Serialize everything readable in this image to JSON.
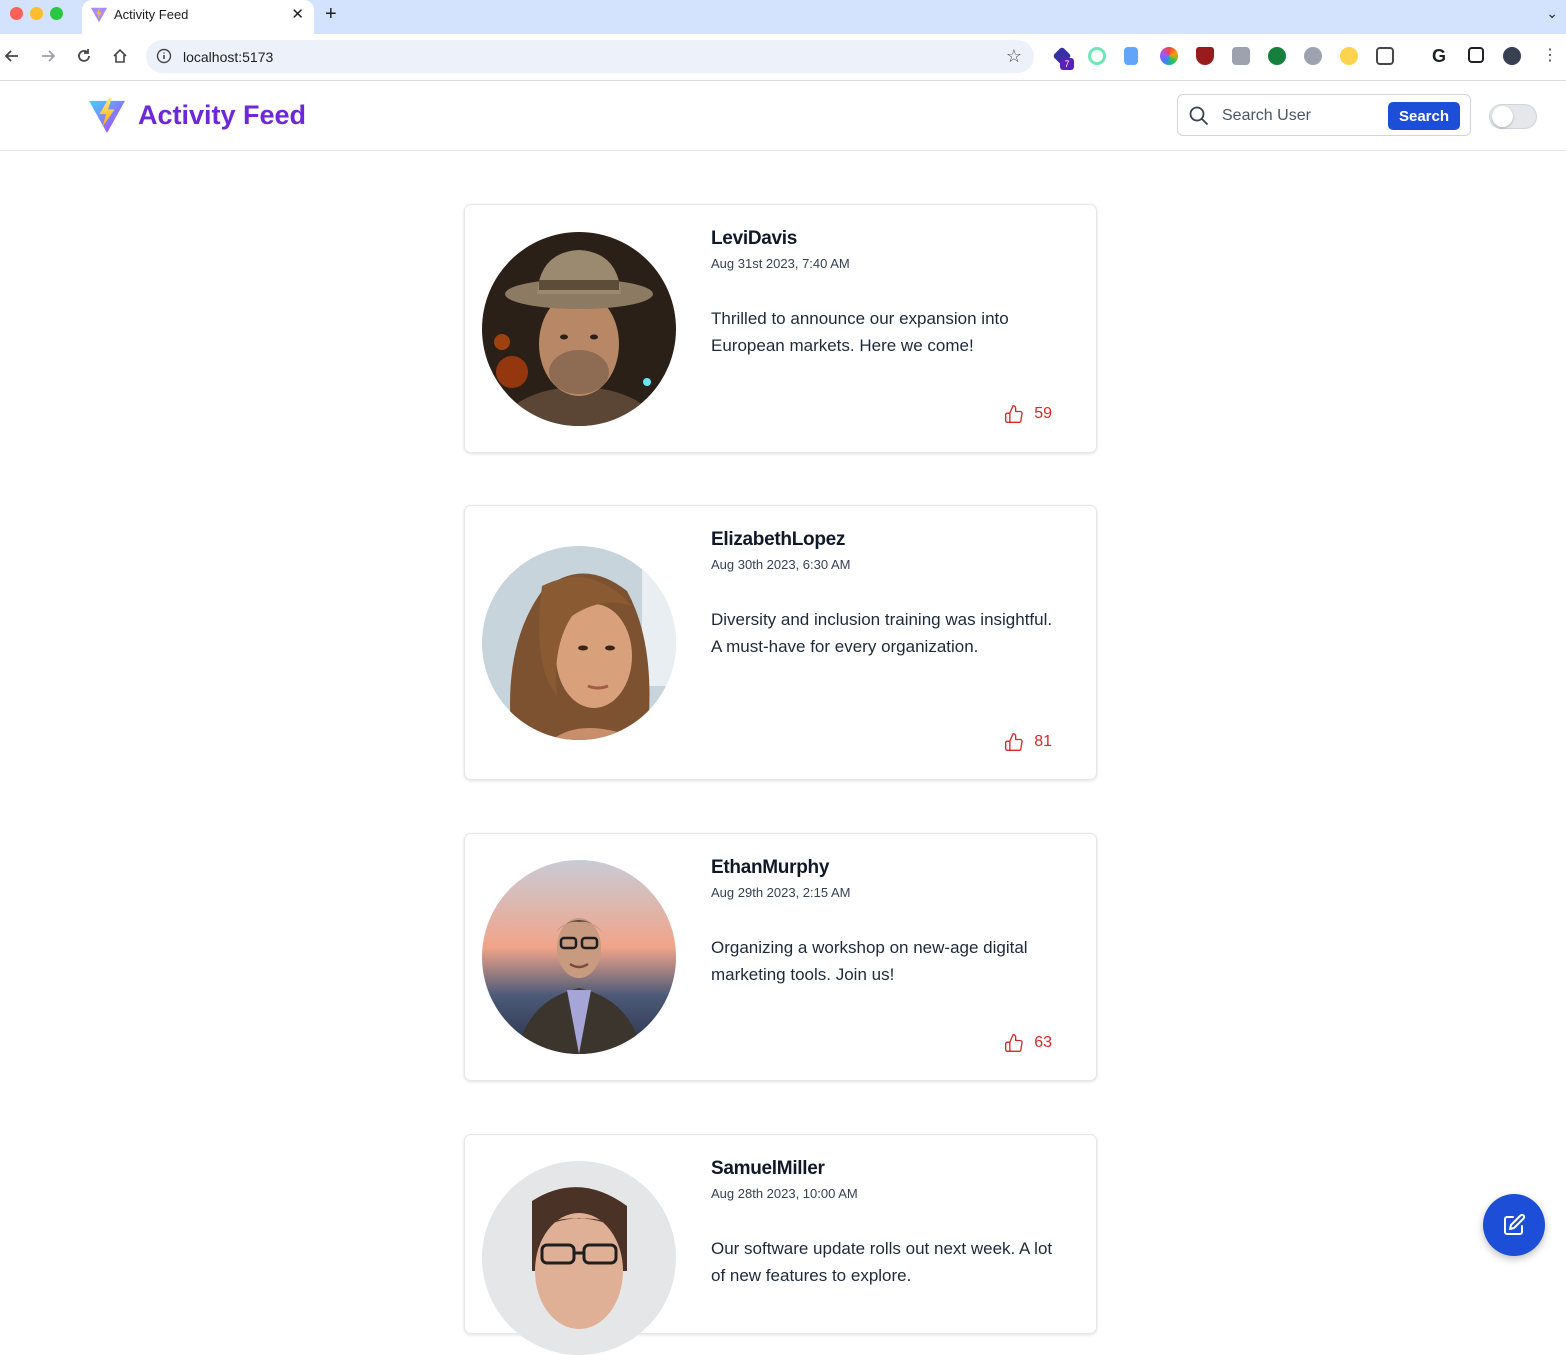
{
  "browser": {
    "tab_title": "Activity Feed",
    "url": "localhost:5173",
    "extension_badge": "7"
  },
  "header": {
    "brand": "Activity Feed",
    "search_placeholder": "Search User",
    "search_button": "Search",
    "dark_mode_enabled": false
  },
  "colors": {
    "brand": "#6d28d9",
    "primary": "#1d4ed8",
    "like": "#dc2626"
  },
  "posts": [
    {
      "username": "LeviDavis",
      "timestamp": "Aug 31st 2023, 7:40 AM",
      "content": "Thrilled to announce our expansion into European markets. Here we come!",
      "likes": "59"
    },
    {
      "username": "ElizabethLopez",
      "timestamp": "Aug 30th 2023, 6:30 AM",
      "content": "Diversity and inclusion training was insightful. A must-have for every organization.",
      "likes": "81"
    },
    {
      "username": "EthanMurphy",
      "timestamp": "Aug 29th 2023, 2:15 AM",
      "content": "Organizing a workshop on new-age digital marketing tools. Join us!",
      "likes": "63"
    },
    {
      "username": "SamuelMiller",
      "timestamp": "Aug 28th 2023, 10:00 AM",
      "content": "Our software update rolls out next week. A lot of new features to explore."
    }
  ],
  "icons": {
    "like": "thumbs-up-icon",
    "fab": "edit-icon",
    "search": "search-icon"
  }
}
